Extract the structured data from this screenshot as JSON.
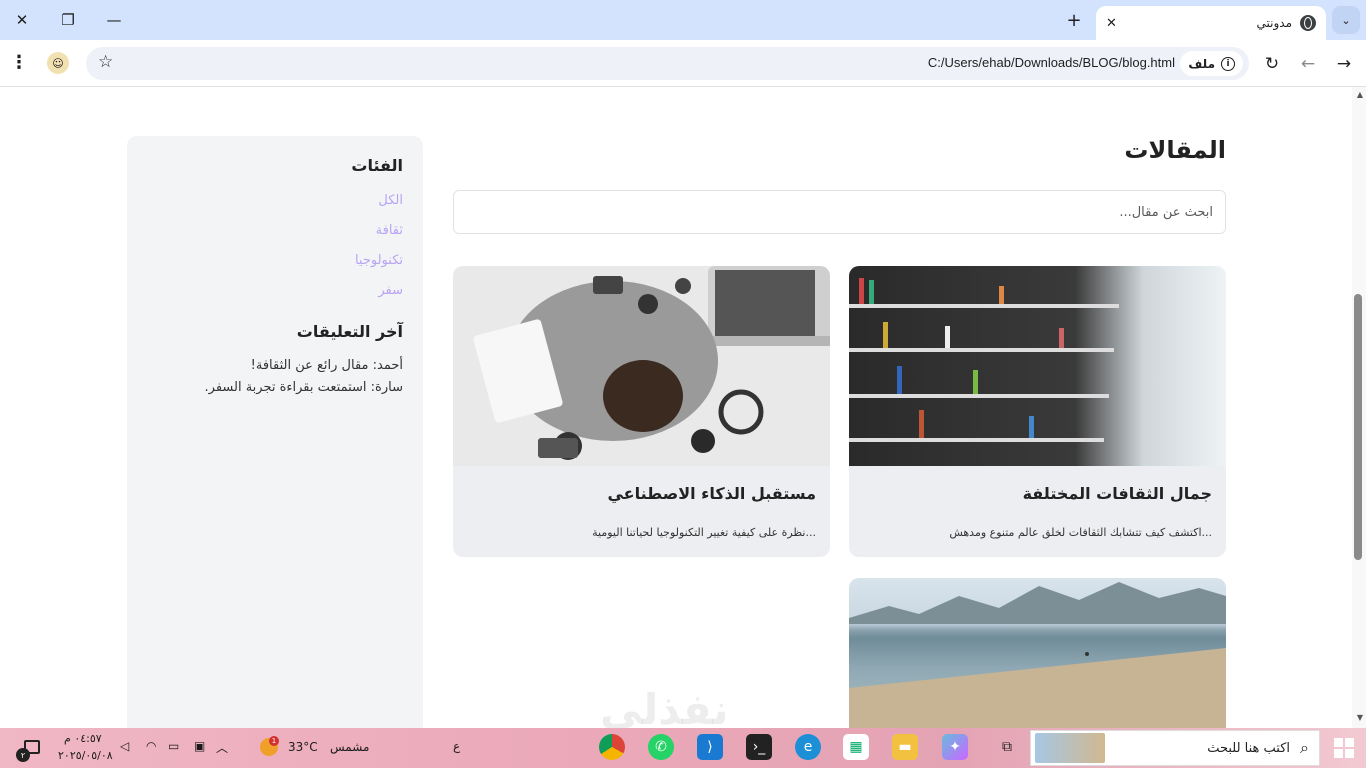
{
  "browser": {
    "tab_title": "مدونتي",
    "chip_label": "ملف",
    "url": "C:/Users/ehab/Downloads/BLOG/blog.html"
  },
  "sidebar": {
    "categories_title": "الفئات",
    "categories": [
      "الكل",
      "ثقافة",
      "تكنولوجيا",
      "سفر"
    ],
    "comments_title": "آخر التعليقات",
    "comments": [
      "أحمد: مقال رائع عن الثقافة!",
      "سارة: استمتعت بقراءة تجربة السفر."
    ]
  },
  "main": {
    "title": "المقالات",
    "search_placeholder": "ابحث عن مقال...",
    "articles": [
      {
        "title": "جمال الثقافات المختلفة",
        "desc": "اكتشف كيف تتشابك الثقافات لخلق عالم متنوع ومدهش..."
      },
      {
        "title": "مستقبل الذكاء الاصطناعي",
        "desc": "نظرة على كيفية تغيير التكنولوجيا لحياتنا اليومية..."
      },
      {
        "title": "",
        "desc": ""
      }
    ]
  },
  "watermark": "نفذلي",
  "taskbar": {
    "search_placeholder": "اكتب هنا للبحث",
    "weather_temp": "33°C",
    "weather_label": "مشمس",
    "time": "٠٤:٥٧ م",
    "date": "٢٠٢٥/٠٥/٠٨",
    "lang": "ع",
    "notif_count": "٢",
    "weather_alert_count": "1"
  }
}
